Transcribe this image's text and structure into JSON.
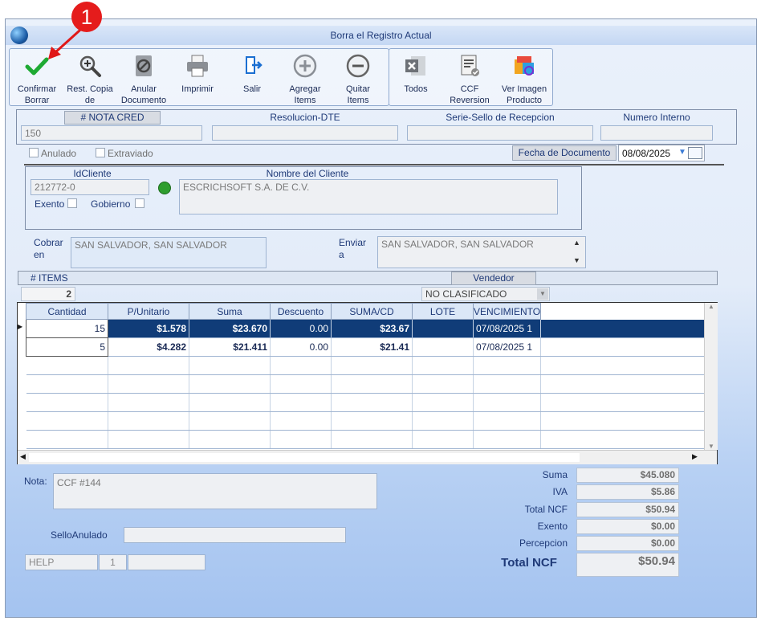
{
  "window": {
    "title": "Borra el Registro Actual"
  },
  "annotation": {
    "number": "1"
  },
  "toolbar": {
    "confirmar": [
      "Confirmar",
      "Borrar"
    ],
    "rest_copia": [
      "Rest. Copia",
      "de"
    ],
    "anular": [
      "Anular",
      "Documento"
    ],
    "imprimir": "Imprimir",
    "salir": "Salir",
    "agregar": [
      "Agregar",
      "Items"
    ],
    "quitar": [
      "Quitar",
      "Items"
    ],
    "todos": "Todos",
    "ccf_rev": [
      "CCF",
      "Reversion"
    ],
    "ver_imagen": [
      "Ver Imagen",
      "Producto"
    ]
  },
  "header": {
    "nota_cred_label": "# NOTA CRED",
    "nota_cred_value": "150",
    "resolucion_label": "Resolucion-DTE",
    "serie_label": "Serie-Sello de Recepcion",
    "numero_interno_label": "Numero Interno",
    "anulado": "Anulado",
    "extraviado": "Extraviado",
    "fecha_label": "Fecha de  Documento",
    "fecha_value": "08/08/2025"
  },
  "cliente": {
    "id_label": "IdCliente",
    "id_value": "212772-0",
    "nombre_label": "Nombre del Cliente",
    "nombre_value": "ESCRICHSOFT S.A. DE C.V.",
    "exento": "Exento",
    "gobierno": "Gobierno"
  },
  "direcciones": {
    "cobrar_label": [
      "Cobrar",
      "en"
    ],
    "cobrar_value": "SAN SALVADOR, SAN SALVADOR",
    "enviar_label": [
      "Enviar",
      "a"
    ],
    "enviar_value": "SAN SALVADOR, SAN SALVADOR"
  },
  "items_bar": {
    "items_label": "# ITEMS",
    "items_count": "2",
    "vendedor_label": "Vendedor",
    "vendedor_value": "NO CLASIFICADO"
  },
  "grid": {
    "columns": [
      "Cantidad",
      "P/Unitario",
      "Suma",
      "Descuento",
      "SUMA/CD",
      "LOTE",
      "VENCIMIENTO"
    ],
    "rows": [
      [
        "15",
        "$1.578",
        "$23.670",
        "0.00",
        "$23.67",
        "",
        "07/08/2025 1"
      ],
      [
        "5",
        "$4.282",
        "$21.411",
        "0.00",
        "$21.41",
        "",
        "07/08/2025 1"
      ]
    ]
  },
  "footer": {
    "nota_label": "Nota:",
    "nota_value": "CCF  #144",
    "sello_label": "SelloAnulado",
    "help": "HELP",
    "page": "1"
  },
  "totales": {
    "suma_label": "Suma",
    "suma": "$45.080",
    "iva_label": "IVA",
    "iva": "$5.86",
    "total_ncf_label": "Total NCF",
    "total_ncf": "$50.94",
    "exento_label": "Exento",
    "exento": "$0.00",
    "percepcion_label": "Percepcion",
    "percepcion": "$0.00",
    "total_big_label": "Total NCF",
    "total_big": "$50.94"
  }
}
